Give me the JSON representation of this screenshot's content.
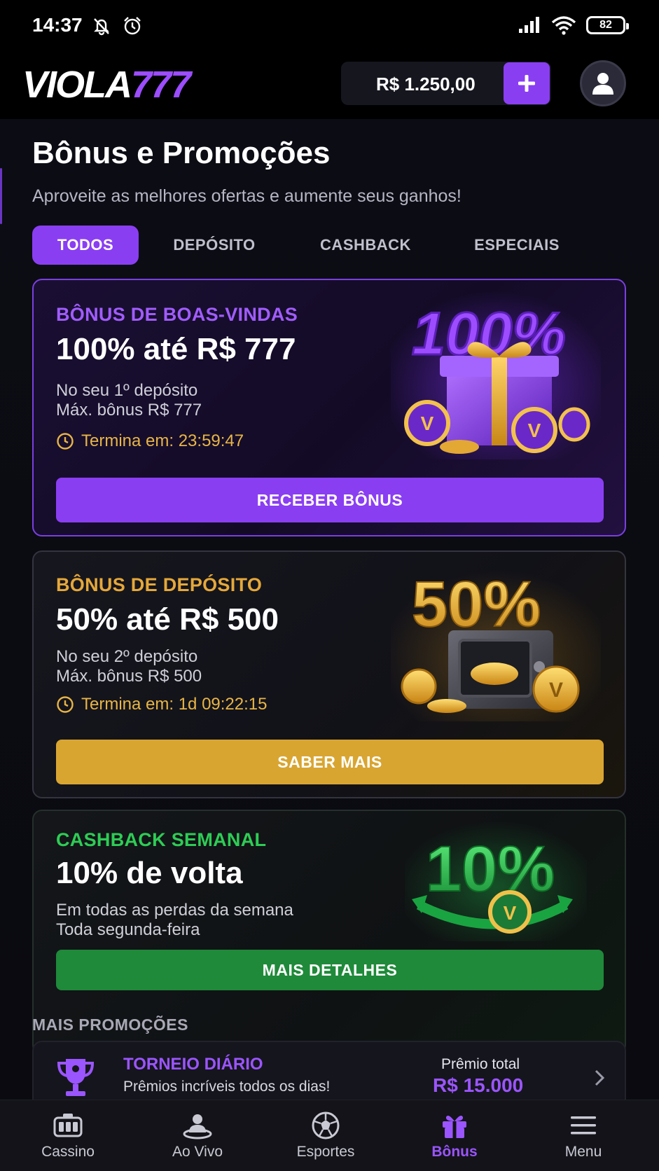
{
  "status_bar": {
    "time": "14:37",
    "battery": "82"
  },
  "header": {
    "logo_white": "VIOLA",
    "logo_purple": "777",
    "balance": "R$ 1.250,00"
  },
  "page": {
    "title": "Bônus e Promoções",
    "subtitle": "Aproveite as melhores ofertas e aumente seus ganhos!"
  },
  "tabs": [
    {
      "label": "TODOS",
      "active": true
    },
    {
      "label": "DEPÓSITO"
    },
    {
      "label": "CASHBACK"
    },
    {
      "label": "ESPECIAIS"
    }
  ],
  "cards": [
    {
      "kicker": "BÔNUS DE BOAS-VINDAS",
      "title": "100% até R$ 777",
      "line1": "No seu 1º depósito",
      "line2": "Máx. bônus R$ 777",
      "timer": "Termina em: 23:59:47",
      "button": "RECEBER BÔNUS",
      "art_text": "100%"
    },
    {
      "kicker": "BÔNUS DE DEPÓSITO",
      "title": "50% até R$ 500",
      "line1": "No seu 2º depósito",
      "line2": "Máx. bônus R$ 500",
      "timer": "Termina em: 1d 09:22:15",
      "button": "SABER MAIS",
      "art_text": "50%"
    },
    {
      "kicker": "CASHBACK SEMANAL",
      "title": "10% de volta",
      "line1": "Em todas as perdas da semana",
      "line2": "Toda segunda-feira",
      "button": "MAIS DETALHES",
      "art_text": "10%"
    }
  ],
  "more": {
    "title": "MAIS PROMOÇÕES",
    "items": [
      {
        "name": "TORNEIO DIÁRIO",
        "desc": "Prêmios incríveis todos os dias!",
        "prize_label": "Prêmio total",
        "prize_value": "R$ 15.000"
      }
    ]
  },
  "nav": [
    {
      "label": "Cassino",
      "icon": "slot-machine-icon"
    },
    {
      "label": "Ao Vivo",
      "icon": "live-dealer-icon"
    },
    {
      "label": "Esportes",
      "icon": "soccer-ball-icon"
    },
    {
      "label": "Bônus",
      "icon": "gift-icon",
      "active": true
    },
    {
      "label": "Menu",
      "icon": "hamburger-icon"
    }
  ],
  "colors": {
    "purple": "#8a3ef2",
    "gold": "#d9a531",
    "green": "#1f8a3a",
    "kicker_purple": "#a15cff",
    "kicker_gold": "#e5a83a",
    "kicker_green": "#2ecc55",
    "timer_gold": "#e8b546"
  }
}
